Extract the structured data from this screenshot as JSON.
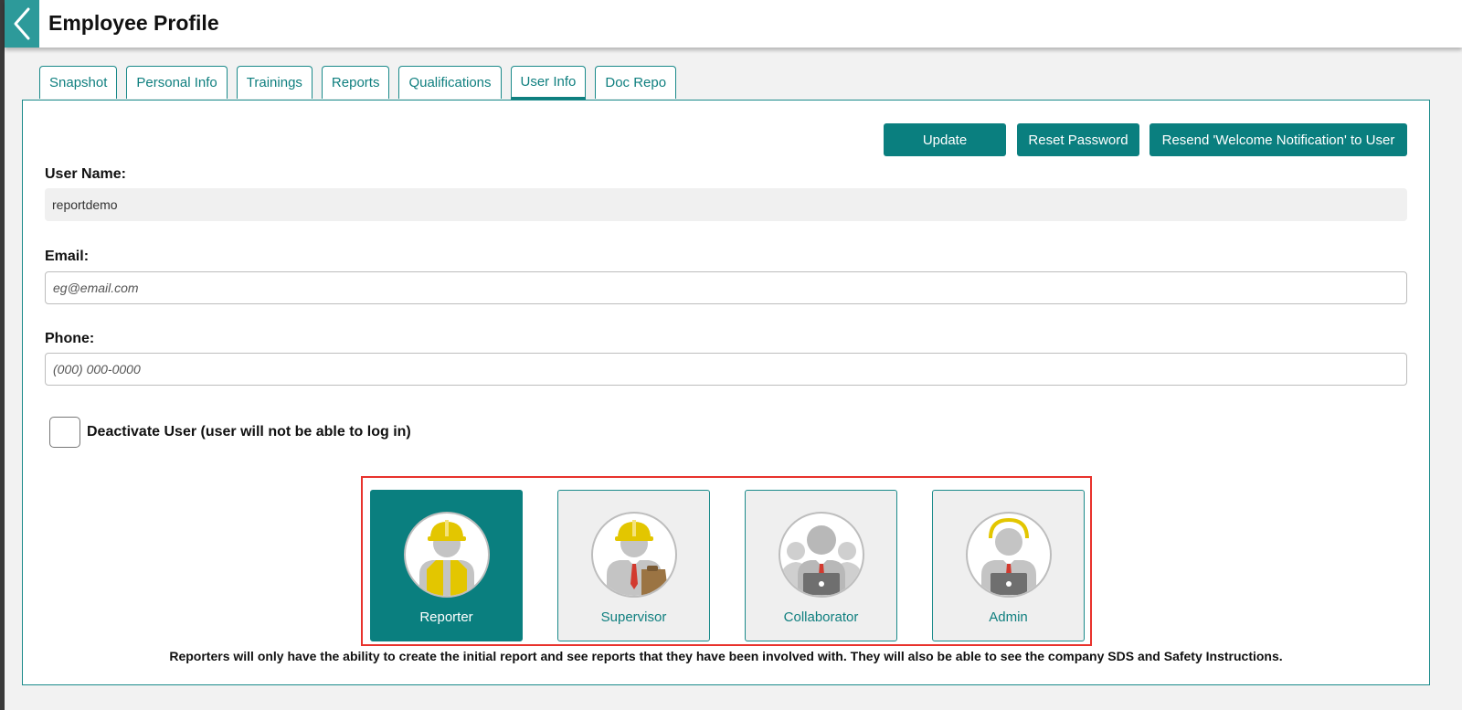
{
  "header": {
    "title": "Employee Profile"
  },
  "tabs": [
    {
      "label": "Snapshot"
    },
    {
      "label": "Personal Info"
    },
    {
      "label": "Trainings"
    },
    {
      "label": "Reports"
    },
    {
      "label": "Qualifications"
    },
    {
      "label": "User Info",
      "active": true
    },
    {
      "label": "Doc Repo"
    }
  ],
  "actions": {
    "update": "Update",
    "reset_password": "Reset Password",
    "resend_welcome": "Resend 'Welcome Notification' to User"
  },
  "form": {
    "username_label": "User Name:",
    "username_value": "reportdemo",
    "email_label": "Email:",
    "email_placeholder": "eg@email.com",
    "phone_label": "Phone:",
    "phone_placeholder": "(000) 000-0000",
    "deactivate_label": "Deactivate User (user will not be able to log in)",
    "deactivate_checked": false
  },
  "roles": {
    "items": [
      {
        "label": "Reporter",
        "icon": "reporter-icon",
        "selected": true
      },
      {
        "label": "Supervisor",
        "icon": "supervisor-icon",
        "selected": false
      },
      {
        "label": "Collaborator",
        "icon": "collaborator-icon",
        "selected": false
      },
      {
        "label": "Admin",
        "icon": "admin-icon",
        "selected": false
      }
    ],
    "description": "Reporters will only have the ability to create the initial report and see reports that they have been involved with. They will also be able to see the company SDS and Safety Instructions."
  },
  "colors": {
    "accent": "#0a7f7f",
    "back_button": "#2d9a9a",
    "highlight_border": "#e8322c",
    "hardhat": "#e3c600"
  }
}
